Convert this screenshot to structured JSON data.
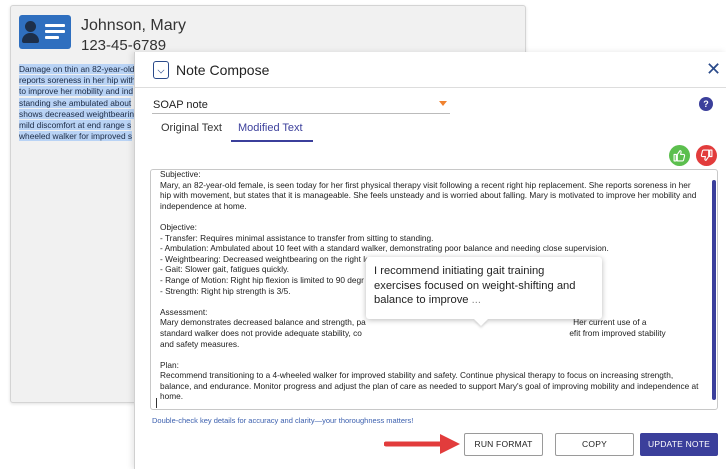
{
  "patient": {
    "name": "Johnson, Mary",
    "id_number": "123-45-6789",
    "source_text_lines": [
      "Damage on thin an 82-year-old",
      "reports soreness in her hip with",
      "to improve her mobility and ind",
      "standing she ambulated about",
      "shows decreased weightbearin",
      "mild discomfort at end range s",
      "wheeled walker for improved s"
    ]
  },
  "modal": {
    "title": "Note Compose",
    "note_type": "SOAP note",
    "help_label": "?",
    "tabs": [
      {
        "label": "Original Text",
        "active": false
      },
      {
        "label": "Modified Text",
        "active": true
      }
    ],
    "editor": {
      "partial_header": "Subjective:",
      "lines": [
        "Mary, an 82-year-old female, is seen today for her first physical therapy visit following a recent right hip replacement. She reports soreness in her",
        "hip with movement, but states that it is manageable. She feels unsteady and is worried about falling. Mary is motivated to improve her mobility and",
        "independence at home.",
        "",
        "Objective:",
        "- Transfer: Requires minimal assistance to transfer from sitting to standing.",
        "- Ambulation: Ambulated about 10 feet with a standard walker, demonstrating poor balance and needing close supervision.",
        "- Weightbearing: Decreased weightbearing on the right leg.",
        "- Gait: Slower gait, fatigues quickly.",
        "- Range of Motion: Right hip flexion is limited to 90 degr",
        "- Strength: Right hip strength is 3/5.",
        "",
        "Assessment:",
        "Mary demonstrates decreased balance and strength, pa                                                                                          Her current use of a",
        "standard walker does not provide adequate stability, co                                                                                          efit from improved stability",
        "and safety measures.",
        "",
        "Plan:",
        "Recommend transitioning to a 4-wheeled walker for improved stability and safety. Continue physical therapy to focus on increasing strength,",
        "balance, and endurance. Monitor progress and adjust the plan of care as needed to support Mary's goal of improving mobility and independence at",
        "home."
      ]
    },
    "suggestion": {
      "text": "I recommend initiating gait training exercises focused on weight-shifting and balance to improve",
      "ellipsis": "..."
    },
    "hint": "Double-check key details for accuracy and clarity—your thoroughness matters!",
    "buttons": {
      "run_format": "RUN FORMAT",
      "copy": "COPY",
      "update_note": "UPDATE NOTE"
    }
  },
  "colors": {
    "accent": "#3b3f9b",
    "dropdown_caret": "#f0822f",
    "thumbs_up": "#5cbf4e",
    "thumbs_down": "#e23c3c",
    "arrow": "#e23c3c",
    "highlight": "#b9d3f5"
  },
  "icons": [
    "patient-id-card-icon",
    "compose-icon",
    "close-icon",
    "chevron-down-icon",
    "help-icon",
    "thumbs-up-icon",
    "thumbs-down-icon",
    "arrow-right-icon"
  ]
}
